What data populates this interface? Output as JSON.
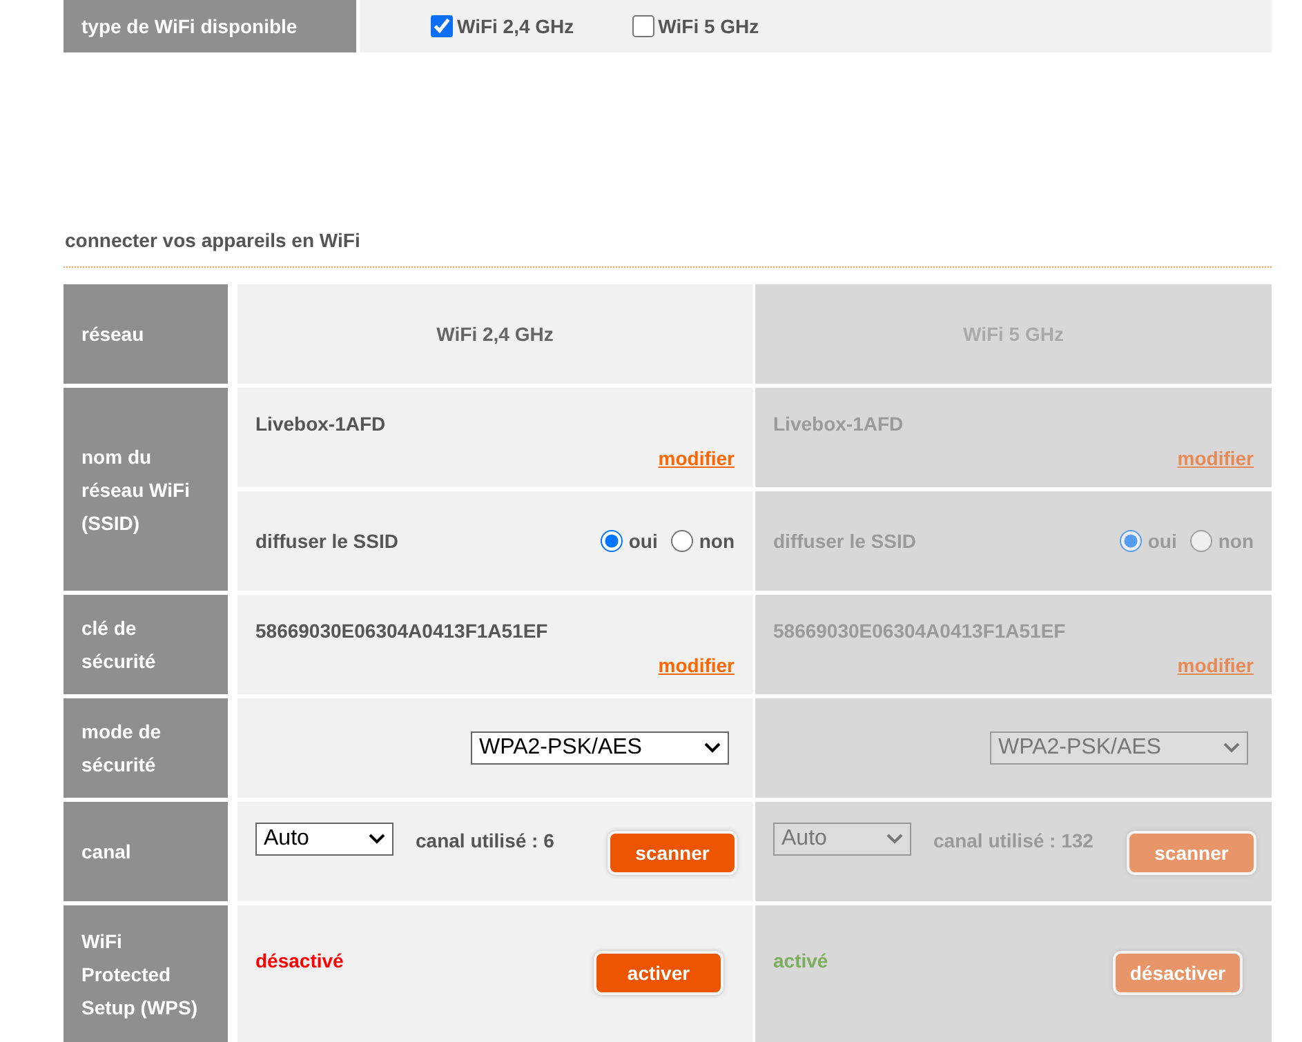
{
  "wifi_type": {
    "label": "type de WiFi disponible",
    "options": [
      {
        "label": "WiFi 2,4 GHz",
        "checked": true
      },
      {
        "label": "WiFi 5 GHz",
        "checked": false
      }
    ]
  },
  "section_title": "connecter vos appareils en WiFi",
  "row_labels": {
    "network": "réseau",
    "ssid": "nom du réseau WiFi (SSID)",
    "key": "clé de sécurité",
    "mode": "mode de sécurité",
    "channel": "canal",
    "wps": "WiFi Protected Setup (WPS)"
  },
  "columns": [
    {
      "header": "WiFi 2,4 GHz",
      "disabled": false,
      "ssid": "Livebox-1AFD",
      "ssid_link": "modifier",
      "broadcast_label": "diffuser le SSID",
      "broadcast_options": [
        {
          "label": "oui",
          "selected": true
        },
        {
          "label": "non",
          "selected": false
        }
      ],
      "key": "58669030E06304A0413F1A51EF",
      "key_link": "modifier",
      "security_mode": "WPA2-PSK/AES",
      "channel": "Auto",
      "channel_used": "canal utilisé : 6",
      "scan_button": "scanner",
      "wps_status": "désactivé",
      "wps_active": false,
      "wps_button": "activer"
    },
    {
      "header": "WiFi 5 GHz",
      "disabled": true,
      "ssid": "Livebox-1AFD",
      "ssid_link": "modifier",
      "broadcast_label": "diffuser le SSID",
      "broadcast_options": [
        {
          "label": "oui",
          "selected": true
        },
        {
          "label": "non",
          "selected": false
        }
      ],
      "key": "58669030E06304A0413F1A51EF",
      "key_link": "modifier",
      "security_mode": "WPA2-PSK/AES",
      "channel": "Auto",
      "channel_used": "canal utilisé : 132",
      "scan_button": "scanner",
      "wps_status": "activé",
      "wps_active": true,
      "wps_button": "désactiver"
    }
  ]
}
